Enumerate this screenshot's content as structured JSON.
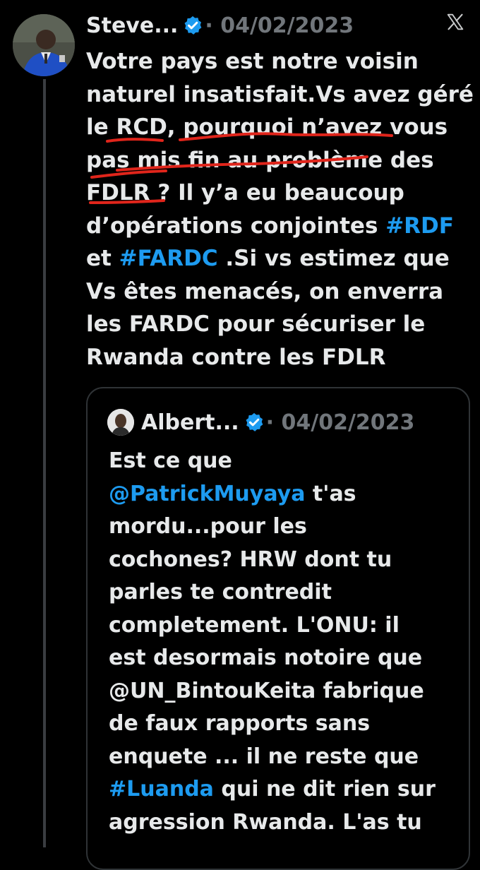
{
  "icons": {
    "x_logo": "x-logo-icon",
    "verified": "verified-badge-icon"
  },
  "colors": {
    "background": "#000000",
    "text": "#e7e9ea",
    "muted": "#71767b",
    "link": "#1d9bf0",
    "verified": "#1d9bf0",
    "annotation": "#e0251b"
  },
  "tweet": {
    "author": "Steve...",
    "meta": "· 04/02/2023",
    "lines": [
      [
        {
          "t": "Votre pays est notre voisin"
        }
      ],
      [
        {
          "t": "naturel insatisfait.Vs avez géré"
        }
      ],
      [
        {
          "t": "le RCD, pourquoi n’avez vous"
        }
      ],
      [
        {
          "t": "pas mis fin au problème des"
        }
      ],
      [
        {
          "t": "FDLR ? Il y’a eu beaucoup"
        }
      ],
      [
        {
          "t": "d’opérations conjointes "
        },
        {
          "t": "#RDF",
          "link": true
        }
      ],
      [
        {
          "t": "et "
        },
        {
          "t": "#FARDC",
          "link": true
        },
        {
          "t": " .Si vs estimez que"
        }
      ],
      [
        {
          "t": "Vs êtes menacés, on enverra"
        }
      ],
      [
        {
          "t": "les FARDC pour sécuriser le"
        }
      ],
      [
        {
          "t": "Rwanda contre les FDLR"
        }
      ]
    ]
  },
  "quote": {
    "author": "Albert...",
    "meta": "· 04/02/2023",
    "lines": [
      [
        {
          "t": "Est ce que"
        }
      ],
      [
        {
          "t": "@PatrickMuyaya",
          "link": true
        },
        {
          "t": " t'as"
        }
      ],
      [
        {
          "t": "mordu...pour les"
        }
      ],
      [
        {
          "t": "cochones? HRW dont tu"
        }
      ],
      [
        {
          "t": "parles te contredit"
        }
      ],
      [
        {
          "t": "completement. L'ONU: il"
        }
      ],
      [
        {
          "t": "est desormais notoire que"
        }
      ],
      [
        {
          "t": "@UN_BintouKeita fabrique"
        }
      ],
      [
        {
          "t": "de faux rapports sans"
        }
      ],
      [
        {
          "t": "enquete ... il ne reste que"
        }
      ],
      [
        {
          "t": "#Luanda",
          "link": true
        },
        {
          "t": " qui ne dit rien sur"
        }
      ],
      [
        {
          "t": "agression Rwanda. L'as tu"
        }
      ]
    ]
  }
}
